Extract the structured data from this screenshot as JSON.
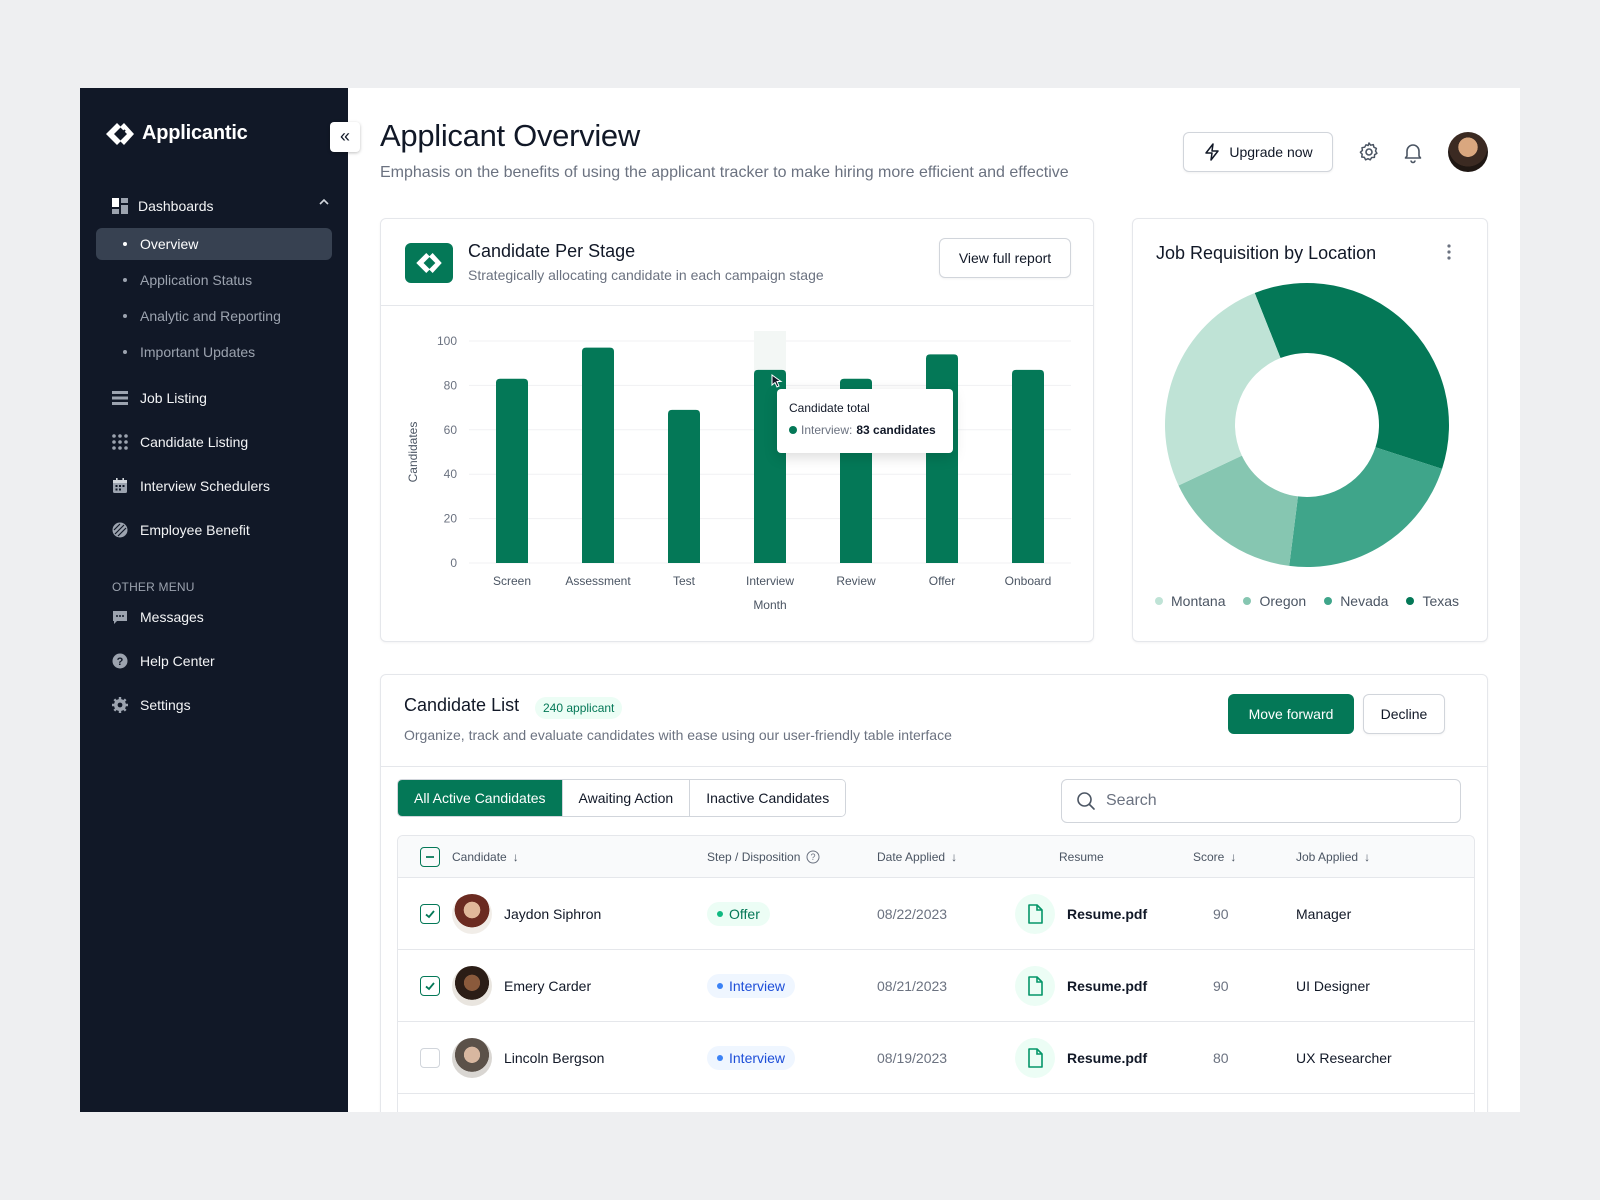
{
  "app": {
    "name": "Applicantic"
  },
  "colors": {
    "accent": "#047857",
    "sidebar": "#111827"
  },
  "sidebar": {
    "collapse_icon": "double-chevron-left-icon",
    "group": {
      "label": "Dashboards",
      "icon": "dashboard-icon",
      "expanded": true
    },
    "sub_items": [
      {
        "label": "Overview",
        "active": true
      },
      {
        "label": "Application Status",
        "active": false
      },
      {
        "label": "Analytic and Reporting",
        "active": false
      },
      {
        "label": "Important Updates",
        "active": false
      }
    ],
    "items": [
      {
        "label": "Job Listing",
        "icon": "list-icon"
      },
      {
        "label": "Candidate Listing",
        "icon": "grid-dots-icon"
      },
      {
        "label": "Interview Schedulers",
        "icon": "calendar-icon"
      },
      {
        "label": "Employee Benefit",
        "icon": "benefit-icon"
      }
    ],
    "other_menu_label": "OTHER MENU",
    "other_items": [
      {
        "label": "Messages",
        "icon": "message-icon"
      },
      {
        "label": "Help Center",
        "icon": "help-icon"
      },
      {
        "label": "Settings",
        "icon": "settings-icon"
      }
    ]
  },
  "header": {
    "title": "Applicant Overview",
    "subtitle": "Emphasis on the benefits of using the applicant tracker to make hiring more efficient and effective",
    "upgrade_label": "Upgrade now"
  },
  "stage_card": {
    "title": "Candidate Per Stage",
    "subtitle": "Strategically allocating candidate in each campaign stage",
    "button_label": "View full report",
    "tooltip": {
      "title": "Candidate total",
      "series": "Interview:",
      "value": "83 candidates"
    }
  },
  "location_card": {
    "title": "Job Requisition by Location"
  },
  "candidate_list": {
    "title": "Candidate List",
    "count_label": "240 applicant",
    "subtitle": "Organize, track and evaluate candidates with ease using our user-friendly table interface",
    "move_forward_label": "Move forward",
    "decline_label": "Decline",
    "tabs": [
      {
        "label": "All Active Candidates",
        "active": true
      },
      {
        "label": "Awaiting Action",
        "active": false
      },
      {
        "label": "Inactive Candidates",
        "active": false
      }
    ],
    "search_placeholder": "Search",
    "columns": [
      "Candidate",
      "Step / Disposition",
      "Date Applied",
      "Resume",
      "Score",
      "Job Applied"
    ],
    "rows": [
      {
        "name": "Jaydon Siphron",
        "step": "Offer",
        "step_type": "offer",
        "date": "08/22/2023",
        "resume": "Resume.pdf",
        "score": "90",
        "job": "Manager",
        "checked": true
      },
      {
        "name": "Emery Carder",
        "step": "Interview",
        "step_type": "interview",
        "date": "08/21/2023",
        "resume": "Resume.pdf",
        "score": "90",
        "job": "UI Designer",
        "checked": true
      },
      {
        "name": "Lincoln Bergson",
        "step": "Interview",
        "step_type": "interview",
        "date": "08/19/2023",
        "resume": "Resume.pdf",
        "score": "80",
        "job": "UX Researcher",
        "checked": false
      }
    ]
  },
  "chart_data": [
    {
      "type": "bar",
      "title": "Candidate Per Stage",
      "xlabel": "Month",
      "ylabel": "Candidates",
      "ylim": [
        0,
        100
      ],
      "yticks": [
        0,
        20,
        40,
        60,
        80,
        100
      ],
      "categories": [
        "Screen",
        "Assessment",
        "Test",
        "Interview",
        "Review",
        "Offer",
        "Onboard"
      ],
      "values": [
        83,
        97,
        69,
        87,
        83,
        94,
        87
      ],
      "highlighted": "Interview",
      "color": "#047857",
      "grid": true
    },
    {
      "type": "pie",
      "title": "Job Requisition by Location",
      "donut": true,
      "labels": [
        "Texas",
        "Nevada",
        "Oregon",
        "Montana"
      ],
      "values": [
        36,
        22,
        16,
        26
      ],
      "colors": [
        "#047857",
        "#3fa58a",
        "#86c6b1",
        "#bfe3d6"
      ],
      "legend_order": [
        "Montana",
        "Oregon",
        "Nevada",
        "Texas"
      ],
      "legend": "bottom"
    }
  ]
}
